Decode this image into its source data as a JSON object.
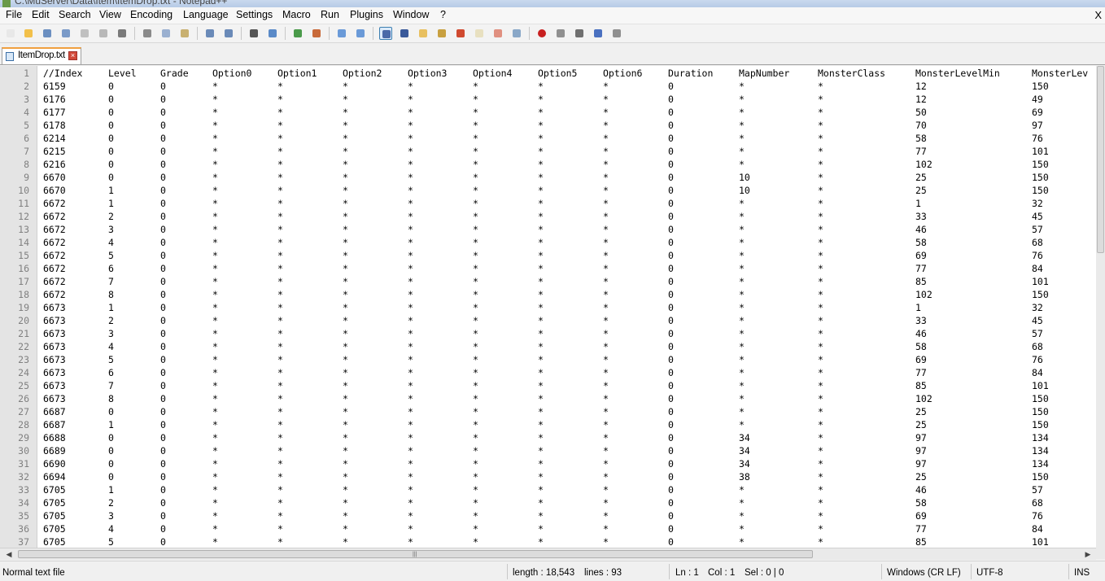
{
  "window": {
    "title": "C:\\MuServer\\Data\\Item\\ItemDrop.txt - Notepad++",
    "close_glyph": "X"
  },
  "menu": [
    "File",
    "Edit",
    "Search",
    "View",
    "Encoding",
    "Language",
    "Settings",
    "Macro",
    "Run",
    "Plugins",
    "Window",
    "?"
  ],
  "toolbar_icons": [
    "new-file-icon",
    "open-file-icon",
    "save-icon",
    "save-all-icon",
    "close-icon",
    "close-all-icon",
    "print-icon",
    "cut-icon",
    "copy-icon",
    "paste-icon",
    "undo-icon",
    "redo-icon",
    "find-icon",
    "replace-icon",
    "zoom-in-icon",
    "zoom-out-icon",
    "sync-vertical-icon",
    "sync-horizontal-icon",
    "word-wrap-icon",
    "show-all-chars-icon",
    "indent-guide-icon",
    "user-lang-icon",
    "doc-map-icon",
    "function-list-icon",
    "folder-workspace-icon",
    "monitor-icon",
    "record-macro-icon",
    "stop-record-icon",
    "play-macro-icon",
    "run-macro-multiple-icon",
    "save-macro-icon"
  ],
  "tab": {
    "filename": "ItemDrop.txt"
  },
  "columns": [
    "//Index",
    "Level",
    "Grade",
    "Option0",
    "Option1",
    "Option2",
    "Option3",
    "Option4",
    "Option5",
    "Option6",
    "Duration",
    "MapNumber",
    "MonsterClass",
    "MonsterLevelMin",
    "MonsterLev"
  ],
  "rows": [
    [
      "6159",
      "0",
      "0",
      "*",
      "*",
      "*",
      "*",
      "*",
      "*",
      "*",
      "0",
      "*",
      "*",
      "12",
      "150"
    ],
    [
      "6176",
      "0",
      "0",
      "*",
      "*",
      "*",
      "*",
      "*",
      "*",
      "*",
      "0",
      "*",
      "*",
      "12",
      "49"
    ],
    [
      "6177",
      "0",
      "0",
      "*",
      "*",
      "*",
      "*",
      "*",
      "*",
      "*",
      "0",
      "*",
      "*",
      "50",
      "69"
    ],
    [
      "6178",
      "0",
      "0",
      "*",
      "*",
      "*",
      "*",
      "*",
      "*",
      "*",
      "0",
      "*",
      "*",
      "70",
      "97"
    ],
    [
      "6214",
      "0",
      "0",
      "*",
      "*",
      "*",
      "*",
      "*",
      "*",
      "*",
      "0",
      "*",
      "*",
      "58",
      "76"
    ],
    [
      "6215",
      "0",
      "0",
      "*",
      "*",
      "*",
      "*",
      "*",
      "*",
      "*",
      "0",
      "*",
      "*",
      "77",
      "101"
    ],
    [
      "6216",
      "0",
      "0",
      "*",
      "*",
      "*",
      "*",
      "*",
      "*",
      "*",
      "0",
      "*",
      "*",
      "102",
      "150"
    ],
    [
      "6670",
      "0",
      "0",
      "*",
      "*",
      "*",
      "*",
      "*",
      "*",
      "*",
      "0",
      "10",
      "*",
      "25",
      "150"
    ],
    [
      "6670",
      "1",
      "0",
      "*",
      "*",
      "*",
      "*",
      "*",
      "*",
      "*",
      "0",
      "10",
      "*",
      "25",
      "150"
    ],
    [
      "6672",
      "1",
      "0",
      "*",
      "*",
      "*",
      "*",
      "*",
      "*",
      "*",
      "0",
      "*",
      "*",
      "1",
      "32"
    ],
    [
      "6672",
      "2",
      "0",
      "*",
      "*",
      "*",
      "*",
      "*",
      "*",
      "*",
      "0",
      "*",
      "*",
      "33",
      "45"
    ],
    [
      "6672",
      "3",
      "0",
      "*",
      "*",
      "*",
      "*",
      "*",
      "*",
      "*",
      "0",
      "*",
      "*",
      "46",
      "57"
    ],
    [
      "6672",
      "4",
      "0",
      "*",
      "*",
      "*",
      "*",
      "*",
      "*",
      "*",
      "0",
      "*",
      "*",
      "58",
      "68"
    ],
    [
      "6672",
      "5",
      "0",
      "*",
      "*",
      "*",
      "*",
      "*",
      "*",
      "*",
      "0",
      "*",
      "*",
      "69",
      "76"
    ],
    [
      "6672",
      "6",
      "0",
      "*",
      "*",
      "*",
      "*",
      "*",
      "*",
      "*",
      "0",
      "*",
      "*",
      "77",
      "84"
    ],
    [
      "6672",
      "7",
      "0",
      "*",
      "*",
      "*",
      "*",
      "*",
      "*",
      "*",
      "0",
      "*",
      "*",
      "85",
      "101"
    ],
    [
      "6672",
      "8",
      "0",
      "*",
      "*",
      "*",
      "*",
      "*",
      "*",
      "*",
      "0",
      "*",
      "*",
      "102",
      "150"
    ],
    [
      "6673",
      "1",
      "0",
      "*",
      "*",
      "*",
      "*",
      "*",
      "*",
      "*",
      "0",
      "*",
      "*",
      "1",
      "32"
    ],
    [
      "6673",
      "2",
      "0",
      "*",
      "*",
      "*",
      "*",
      "*",
      "*",
      "*",
      "0",
      "*",
      "*",
      "33",
      "45"
    ],
    [
      "6673",
      "3",
      "0",
      "*",
      "*",
      "*",
      "*",
      "*",
      "*",
      "*",
      "0",
      "*",
      "*",
      "46",
      "57"
    ],
    [
      "6673",
      "4",
      "0",
      "*",
      "*",
      "*",
      "*",
      "*",
      "*",
      "*",
      "0",
      "*",
      "*",
      "58",
      "68"
    ],
    [
      "6673",
      "5",
      "0",
      "*",
      "*",
      "*",
      "*",
      "*",
      "*",
      "*",
      "0",
      "*",
      "*",
      "69",
      "76"
    ],
    [
      "6673",
      "6",
      "0",
      "*",
      "*",
      "*",
      "*",
      "*",
      "*",
      "*",
      "0",
      "*",
      "*",
      "77",
      "84"
    ],
    [
      "6673",
      "7",
      "0",
      "*",
      "*",
      "*",
      "*",
      "*",
      "*",
      "*",
      "0",
      "*",
      "*",
      "85",
      "101"
    ],
    [
      "6673",
      "8",
      "0",
      "*",
      "*",
      "*",
      "*",
      "*",
      "*",
      "*",
      "0",
      "*",
      "*",
      "102",
      "150"
    ],
    [
      "6687",
      "0",
      "0",
      "*",
      "*",
      "*",
      "*",
      "*",
      "*",
      "*",
      "0",
      "*",
      "*",
      "25",
      "150"
    ],
    [
      "6687",
      "1",
      "0",
      "*",
      "*",
      "*",
      "*",
      "*",
      "*",
      "*",
      "0",
      "*",
      "*",
      "25",
      "150"
    ],
    [
      "6688",
      "0",
      "0",
      "*",
      "*",
      "*",
      "*",
      "*",
      "*",
      "*",
      "0",
      "34",
      "*",
      "97",
      "134"
    ],
    [
      "6689",
      "0",
      "0",
      "*",
      "*",
      "*",
      "*",
      "*",
      "*",
      "*",
      "0",
      "34",
      "*",
      "97",
      "134"
    ],
    [
      "6690",
      "0",
      "0",
      "*",
      "*",
      "*",
      "*",
      "*",
      "*",
      "*",
      "0",
      "34",
      "*",
      "97",
      "134"
    ],
    [
      "6694",
      "0",
      "0",
      "*",
      "*",
      "*",
      "*",
      "*",
      "*",
      "*",
      "0",
      "38",
      "*",
      "25",
      "150"
    ],
    [
      "6705",
      "1",
      "0",
      "*",
      "*",
      "*",
      "*",
      "*",
      "*",
      "*",
      "0",
      "*",
      "*",
      "46",
      "57"
    ],
    [
      "6705",
      "2",
      "0",
      "*",
      "*",
      "*",
      "*",
      "*",
      "*",
      "*",
      "0",
      "*",
      "*",
      "58",
      "68"
    ],
    [
      "6705",
      "3",
      "0",
      "*",
      "*",
      "*",
      "*",
      "*",
      "*",
      "*",
      "0",
      "*",
      "*",
      "69",
      "76"
    ],
    [
      "6705",
      "4",
      "0",
      "*",
      "*",
      "*",
      "*",
      "*",
      "*",
      "*",
      "0",
      "*",
      "*",
      "77",
      "84"
    ],
    [
      "6705",
      "5",
      "0",
      "*",
      "*",
      "*",
      "*",
      "*",
      "*",
      "*",
      "0",
      "*",
      "*",
      "85",
      "101"
    ]
  ],
  "status": {
    "file_type": "Normal text file",
    "length": "length : 18,543",
    "lines": "lines : 93",
    "ln": "Ln : 1",
    "col": "Col : 1",
    "sel": "Sel : 0 | 0",
    "eol": "Windows (CR LF)",
    "encoding": "UTF-8",
    "mode": "INS"
  }
}
